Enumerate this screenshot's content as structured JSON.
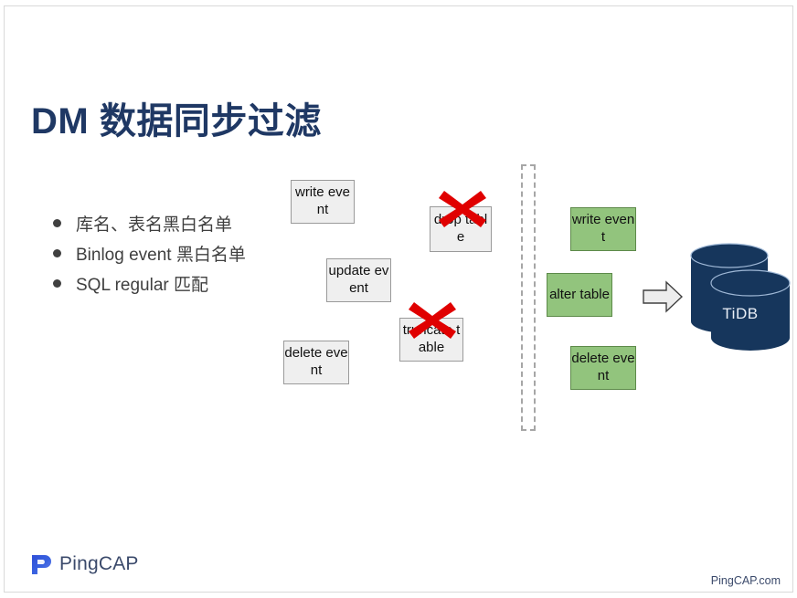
{
  "slide": {
    "title": "DM 数据同步过滤",
    "title_color": "#1f3864",
    "background": "#ffffff"
  },
  "bullets": [
    {
      "text": "库名、表名黑白名单"
    },
    {
      "text": "Binlog event 黑白名单"
    },
    {
      "text": "SQL regular 匹配"
    }
  ],
  "source_events": [
    {
      "label": "write event",
      "kind": "allowed"
    },
    {
      "label": "update event",
      "kind": "allowed"
    },
    {
      "label": "delete event",
      "kind": "allowed"
    },
    {
      "label": "drop table",
      "kind": "blocked"
    },
    {
      "label": "truncate table",
      "kind": "blocked"
    }
  ],
  "filtered_events": [
    {
      "label": "write event"
    },
    {
      "label": "alter table"
    },
    {
      "label": "delete event"
    }
  ],
  "target": {
    "label": "TiDB",
    "fill": "#16365c"
  },
  "icons": {
    "block_marker": "red-x-icon",
    "flow_arrow": "right-block-arrow-icon",
    "filter_barrier": "dashed-filter-divider"
  },
  "colors": {
    "green_box_fill": "#92c47d",
    "green_box_border": "#5d8a4a",
    "white_box_fill": "#efefef",
    "white_box_border": "#9a9a9a",
    "red_x": "#e00000",
    "arrow_fill": "#ededed",
    "arrow_border": "#404040"
  },
  "footer": {
    "logo_text": "PingCAP",
    "url": "PingCAP.com"
  }
}
